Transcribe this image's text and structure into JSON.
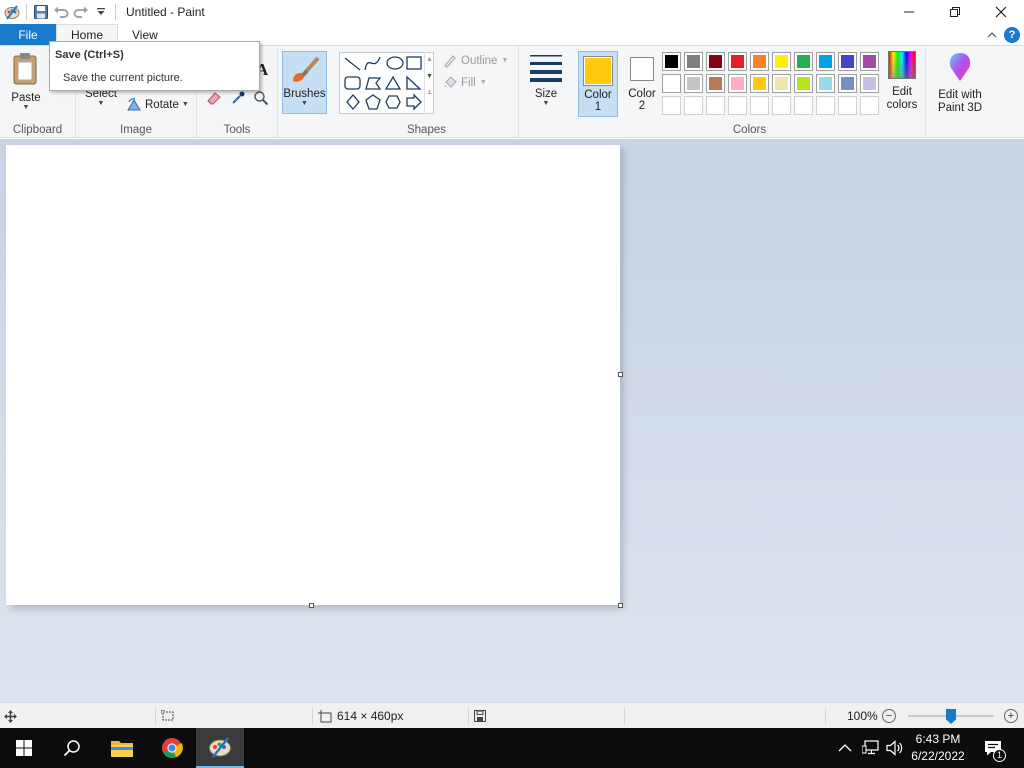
{
  "window": {
    "title": "Untitled - Paint"
  },
  "tabs": {
    "file": "File",
    "home": "Home",
    "view": "View"
  },
  "tooltip": {
    "title": "Save (Ctrl+S)",
    "description": "Save the current picture."
  },
  "ribbon": {
    "clipboard": {
      "label": "Clipboard",
      "paste": "Paste"
    },
    "image": {
      "label": "Image",
      "select": "Select",
      "rotate": "Rotate"
    },
    "tools": {
      "label": "Tools",
      "text_tool": "A"
    },
    "brushes": {
      "label": "Brushes"
    },
    "shapes": {
      "label": "Shapes",
      "outline": "Outline",
      "fill": "Fill"
    },
    "size": {
      "label": "Size"
    },
    "colors": {
      "label": "Colors",
      "color1": {
        "label_line1": "Color",
        "label_line2": "1",
        "value": "#ffc90e"
      },
      "color2": {
        "label_line1": "Color",
        "label_line2": "2",
        "value": "#ffffff"
      },
      "edit_colors": {
        "line1": "Edit",
        "line2": "colors"
      },
      "palette_row1": [
        "#000000",
        "#7f7f7f",
        "#880015",
        "#ed1c24",
        "#ff7f27",
        "#fff200",
        "#22b14c",
        "#00a2e8",
        "#3f48cc",
        "#a349a4"
      ],
      "palette_row2": [
        "#ffffff",
        "#c3c3c3",
        "#b97a57",
        "#ffaec9",
        "#ffc90e",
        "#efe4b0",
        "#b5e61d",
        "#99d9ea",
        "#7092be",
        "#c8bfe7"
      ],
      "palette_row3": [
        "#ffffff",
        "#ffffff",
        "#ffffff",
        "#ffffff",
        "#ffffff",
        "#ffffff",
        "#ffffff",
        "#ffffff",
        "#ffffff",
        "#ffffff"
      ]
    },
    "paint3d": {
      "line1": "Edit with",
      "line2": "Paint 3D"
    }
  },
  "statusbar": {
    "canvas_size": "614 × 460px",
    "zoom": "100%"
  },
  "taskbar": {
    "time": "6:43 PM",
    "date": "6/22/2022",
    "notifications": "1"
  },
  "accent_color": "#1979ca"
}
